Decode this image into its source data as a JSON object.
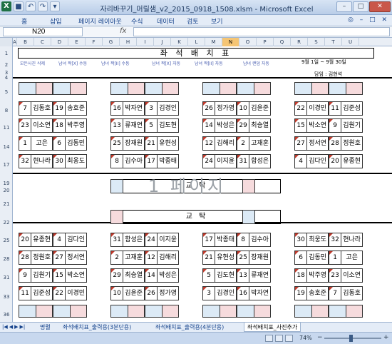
{
  "window": {
    "title": "자리바꾸기_머릴샘_v2_2015_0918_1508.xlsm - Microsoft Excel"
  },
  "ribbon": {
    "tabs": [
      "홈",
      "삽입",
      "페이지 레이아웃",
      "수식",
      "데이터",
      "검토",
      "보기"
    ]
  },
  "formula_bar": {
    "name_box": "N20",
    "fx": "fx",
    "value": ""
  },
  "columns": [
    "A",
    "B",
    "C",
    "D",
    "E",
    "F",
    "G",
    "H",
    "I",
    "J",
    "K",
    "L",
    "M",
    "N",
    "O",
    "P",
    "Q",
    "R",
    "S",
    "T",
    "U"
  ],
  "selected_column": "N",
  "rows": [
    "1",
    "2",
    "3",
    "4",
    "5",
    "8",
    "11",
    "14",
    "17",
    "19",
    "20",
    "21",
    "22",
    "25",
    "28",
    "31",
    "33",
    "36"
  ],
  "sheet": {
    "title": "좌 석 배 치 표",
    "buttons": [
      "모든사진 삭제",
      "남녀 짝[X] 수동",
      "남녀 짝[II] 수동",
      "남녀 짝[X] 자동",
      "남녀 짝[II] 자동",
      "남녀 랜덤 자동"
    ],
    "date_range": "9월 1일 ~ 9월 30일",
    "teacher": "담임 : 김현석",
    "desk_label": "교 탁",
    "watermark": "1 페이지"
  },
  "top_grid": [
    [
      [
        "7",
        "김동호"
      ],
      [
        "19",
        "송호준"
      ],
      [
        "16",
        "박자연"
      ],
      [
        "3",
        "김경인"
      ],
      [
        "26",
        "정가영"
      ],
      [
        "10",
        "김윤준"
      ],
      [
        "22",
        "이경민"
      ],
      [
        "11",
        "김준성"
      ]
    ],
    [
      [
        "23",
        "이소연"
      ],
      [
        "18",
        "박주영"
      ],
      [
        "13",
        "류재연"
      ],
      [
        "5",
        "김도현"
      ],
      [
        "14",
        "박성은"
      ],
      [
        "29",
        "최승열"
      ],
      [
        "15",
        "박소연"
      ],
      [
        "9",
        "김원기"
      ]
    ],
    [
      [
        "1",
        "고은"
      ],
      [
        "6",
        "김동민"
      ],
      [
        "25",
        "장재원"
      ],
      [
        "21",
        "유현성"
      ],
      [
        "12",
        "김해리"
      ],
      [
        "2",
        "고재훈"
      ],
      [
        "27",
        "정서연"
      ],
      [
        "28",
        "정원호"
      ]
    ],
    [
      [
        "32",
        "현나라"
      ],
      [
        "30",
        "최웅도"
      ],
      [
        "8",
        "김수아"
      ],
      [
        "17",
        "박종태"
      ],
      [
        "24",
        "이지윤"
      ],
      [
        "31",
        "함성은"
      ],
      [
        "4",
        "김다인"
      ],
      [
        "20",
        "유종현"
      ]
    ]
  ],
  "bottom_grid": [
    [
      [
        "20",
        "유종현"
      ],
      [
        "4",
        "김다인"
      ],
      [
        "31",
        "함성은"
      ],
      [
        "24",
        "이지윤"
      ],
      [
        "17",
        "박종태"
      ],
      [
        "8",
        "김수아"
      ],
      [
        "30",
        "최웅도"
      ],
      [
        "32",
        "현나라"
      ]
    ],
    [
      [
        "28",
        "정원호"
      ],
      [
        "27",
        "정서연"
      ],
      [
        "2",
        "고재훈"
      ],
      [
        "12",
        "김해리"
      ],
      [
        "21",
        "유현성"
      ],
      [
        "25",
        "장재원"
      ],
      [
        "6",
        "김동민"
      ],
      [
        "1",
        "고은"
      ]
    ],
    [
      [
        "9",
        "김원기"
      ],
      [
        "15",
        "박소연"
      ],
      [
        "29",
        "최승열"
      ],
      [
        "14",
        "박성은"
      ],
      [
        "5",
        "김도현"
      ],
      [
        "13",
        "류재연"
      ],
      [
        "18",
        "박주영"
      ],
      [
        "23",
        "이소연"
      ]
    ],
    [
      [
        "11",
        "김준성"
      ],
      [
        "22",
        "이경민"
      ],
      [
        "10",
        "김윤준"
      ],
      [
        "26",
        "정가영"
      ],
      [
        "3",
        "김경인"
      ],
      [
        "16",
        "박자연"
      ],
      [
        "19",
        "송호준"
      ],
      [
        "7",
        "김동호"
      ]
    ]
  ],
  "sheet_tabs": [
    "명렬",
    "좌석배치표_출력용(3분단용)",
    "좌석배치표_출력용(4분단용)",
    "좌석배치표_사진추가"
  ],
  "active_tab": 3,
  "status": {
    "zoom": "74%",
    "minus": "−",
    "plus": "+"
  },
  "colors": {
    "pair_number_marker": "#c0392b",
    "empty_blue": "#dceaf6",
    "empty_pink": "#f6dbdd"
  }
}
